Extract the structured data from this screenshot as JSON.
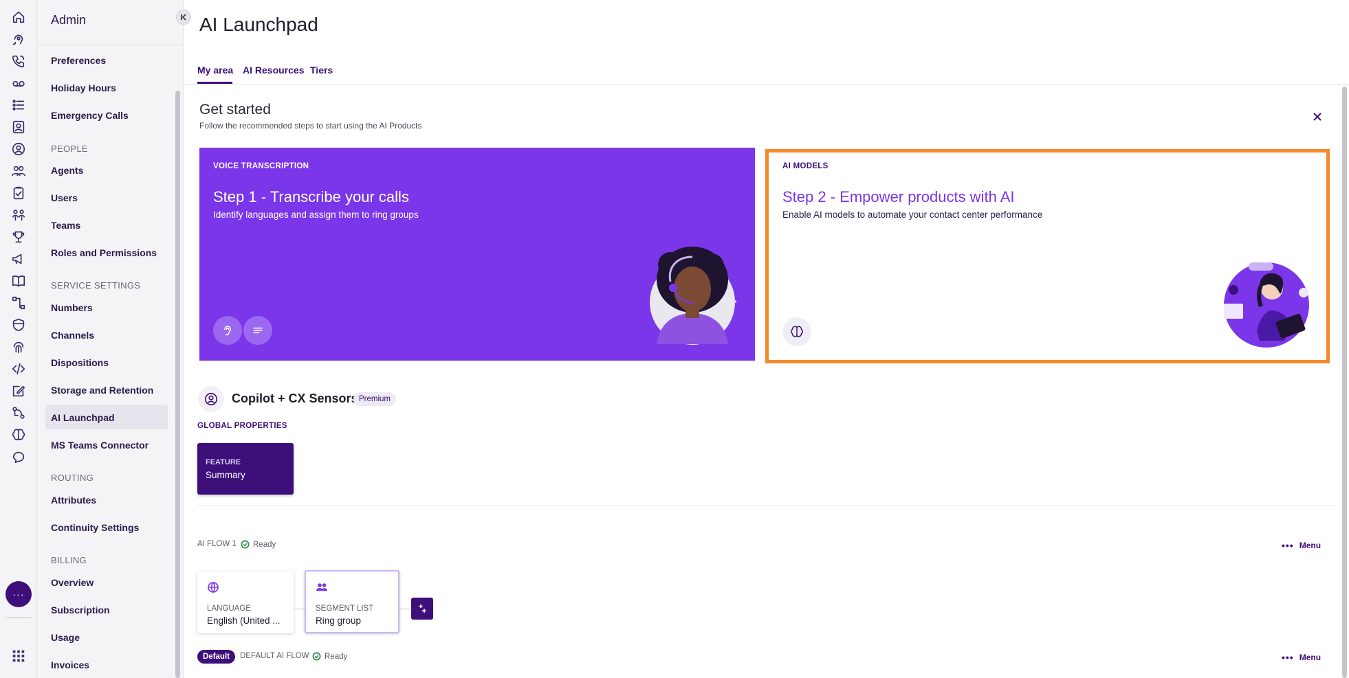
{
  "rail": {
    "icons": [
      "home-icon",
      "voice-agent-icon",
      "phone-call-icon",
      "voicemail-icon",
      "list-icon",
      "contacts-icon",
      "headset-icon",
      "team-icon",
      "clipboard-icon",
      "org-icon",
      "trophy-icon",
      "megaphone-icon",
      "book-icon",
      "flow-icon",
      "shield-icon",
      "fingerprint-icon",
      "code-icon",
      "edit-icon",
      "automation-icon",
      "brain-icon",
      "chat-icon"
    ],
    "more_label": "···"
  },
  "sidebar": {
    "title": "Admin",
    "items": [
      {
        "label": "Preferences"
      },
      {
        "label": "Holiday Hours"
      },
      {
        "label": "Emergency Calls"
      },
      {
        "section": "PEOPLE"
      },
      {
        "label": "Agents"
      },
      {
        "label": "Users"
      },
      {
        "label": "Teams"
      },
      {
        "label": "Roles and Permissions"
      },
      {
        "section": "SERVICE SETTINGS"
      },
      {
        "label": "Numbers"
      },
      {
        "label": "Channels"
      },
      {
        "label": "Dispositions"
      },
      {
        "label": "Storage and Retention"
      },
      {
        "label": "AI Launchpad",
        "active": true
      },
      {
        "label": "MS Teams Connector"
      },
      {
        "section": "ROUTING"
      },
      {
        "label": "Attributes"
      },
      {
        "label": "Continuity Settings"
      },
      {
        "section": "BILLING"
      },
      {
        "label": "Overview"
      },
      {
        "label": "Subscription"
      },
      {
        "label": "Usage"
      },
      {
        "label": "Invoices"
      }
    ]
  },
  "header": {
    "title": "AI Launchpad",
    "tabs": [
      {
        "label": "My area",
        "active": true
      },
      {
        "label": "AI Resources"
      },
      {
        "label": "Tiers"
      }
    ]
  },
  "get_started": {
    "title": "Get started",
    "subtitle": "Follow the recommended steps to start using the AI Products",
    "cards": [
      {
        "label": "VOICE TRANSCRIPTION",
        "title": "Step 1 - Transcribe your calls",
        "description": "Identify languages and assign them to ring groups"
      },
      {
        "label": "AI MODELS",
        "title": "Step 2 - Empower products with AI",
        "description": "Enable AI models to automate your contact center performance"
      }
    ]
  },
  "copilot": {
    "title": "Copilot + CX Sensors",
    "badge": "Premium",
    "global_properties_label": "GLOBAL PROPERTIES",
    "feature": {
      "key": "FEATURE",
      "value": "Summary"
    }
  },
  "flows": [
    {
      "name": "AI FLOW 1",
      "status": "Ready",
      "menu_label": "Menu",
      "nodes": [
        {
          "key": "LANGUAGE",
          "value": "English (United ..."
        },
        {
          "key": "SEGMENT LIST",
          "value": "Ring group"
        }
      ]
    },
    {
      "badge": "Default",
      "name": "DEFAULT AI FLOW",
      "status": "Ready",
      "menu_label": "Menu"
    }
  ],
  "colors": {
    "brand_dark": "#3d0f7a",
    "brand_purple": "#7b36ea",
    "highlight_orange": "#f58a2b",
    "ready_green": "#2e8b4e"
  }
}
